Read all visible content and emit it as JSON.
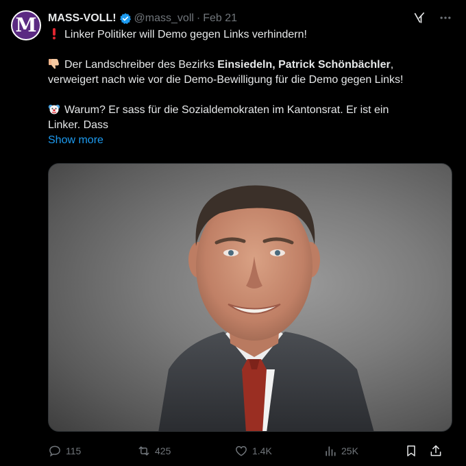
{
  "author": {
    "avatar_letter": "M",
    "name": "MASS-VOLL!",
    "handle": "@mass_voll",
    "separator": "·",
    "date": "Feb 21"
  },
  "tweet": {
    "line1": "Linker Politiker will Demo gegen Links verhindern!",
    "p2_part1": "Der Landschreiber des Bezirks ",
    "p2_bold1": "Einsiedeln, Patrick Schönbächler",
    "p2_part2": ",",
    "p2_line2": "verweigert nach wie vor die Demo-Bewilligung für die Demo gegen Links!",
    "p3_line1": "Warum? Er sass für die Sozialdemokraten im Kantonsrat. Er ist ein",
    "p3_line2": "Linker. Dass",
    "show_more": "Show more"
  },
  "actions": {
    "replies": "115",
    "reposts": "425",
    "likes": "1.4K",
    "views": "25K"
  },
  "colors": {
    "accent": "#1d9bf0",
    "muted": "#71767b",
    "text": "#e7e9ea",
    "background": "#000000"
  },
  "icons": [
    "verified-badge-icon",
    "grok-icon",
    "more-icon",
    "exclamation-emoji",
    "thumbs-down-emoji",
    "clown-emoji",
    "reply-icon",
    "repost-icon",
    "like-icon",
    "views-icon",
    "bookmark-icon",
    "share-icon"
  ]
}
